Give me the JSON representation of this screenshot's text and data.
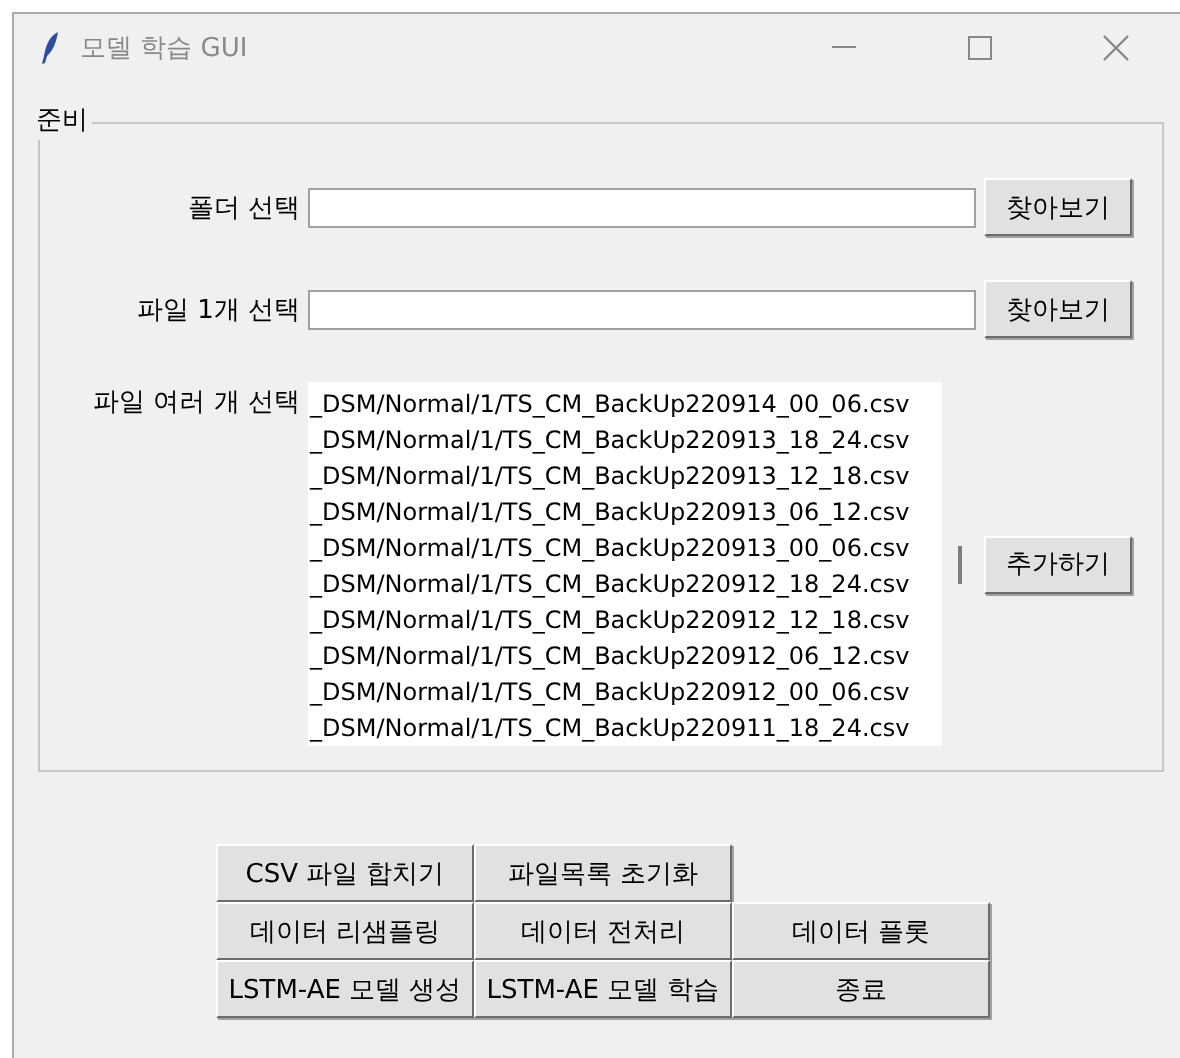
{
  "window": {
    "title": "모델 학습 GUI"
  },
  "group": {
    "title": "준비",
    "fields": [
      {
        "label": "폴더 선택",
        "button": "찾아보기"
      },
      {
        "label": "파일 1개 선택",
        "button": "찾아보기"
      }
    ],
    "file_list": {
      "label": "파일 여러 개 선택",
      "button": "추가하기",
      "items": [
        "_DSM/Normal/1/TS_CM_BackUp220914_00_06.csv",
        "_DSM/Normal/1/TS_CM_BackUp220913_18_24.csv",
        "_DSM/Normal/1/TS_CM_BackUp220913_12_18.csv",
        "_DSM/Normal/1/TS_CM_BackUp220913_06_12.csv",
        "_DSM/Normal/1/TS_CM_BackUp220913_00_06.csv",
        "_DSM/Normal/1/TS_CM_BackUp220912_18_24.csv",
        "_DSM/Normal/1/TS_CM_BackUp220912_12_18.csv",
        "_DSM/Normal/1/TS_CM_BackUp220912_06_12.csv",
        "_DSM/Normal/1/TS_CM_BackUp220912_00_06.csv",
        "_DSM/Normal/1/TS_CM_BackUp220911_18_24.csv"
      ]
    }
  },
  "action_buttons": [
    [
      "CSV 파일 합치기",
      "파일목록 초기화"
    ],
    [
      "데이터 리샘플링",
      "데이터 전처리",
      "데이터 플롯"
    ],
    [
      "LSTM-AE 모델 생성",
      "LSTM-AE 모델 학습",
      "종료"
    ]
  ]
}
